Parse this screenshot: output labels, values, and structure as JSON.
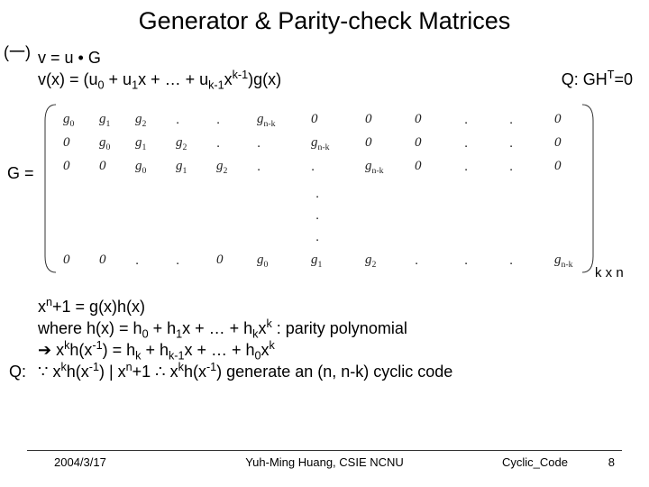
{
  "title": "Generator & Parity-check Matrices",
  "topnote": "(一)",
  "line1": "v = u • G",
  "line2_html": "v(x) = (u<sub>0</sub> + u<sub>1</sub>x + … + u<sub>k-1</sub>x<sup>k-1</sup>)g(x)",
  "q_right_html": "Q: GH<sup>T</sup>=0",
  "g_label": "G =",
  "matrix": {
    "headers_row0": [
      "g<sub>0</sub>",
      "g<sub>1</sub>",
      "g<sub>2</sub>",
      ".",
      ".",
      "g<sub>n-k</sub>",
      "0",
      "0",
      "0",
      ".",
      ".",
      "0"
    ],
    "row1": [
      "0",
      "g<sub>0</sub>",
      "g<sub>1</sub>",
      "g<sub>2</sub>",
      ".",
      ".",
      "g<sub>n-k</sub>",
      "0",
      "0",
      ".",
      ".",
      "0"
    ],
    "row2": [
      "0",
      "0",
      "g<sub>0</sub>",
      "g<sub>1</sub>",
      "g<sub>2</sub>",
      ".",
      ".",
      "g<sub>n-k</sub>",
      "0",
      ".",
      ".",
      "0"
    ],
    "row5": [
      "0",
      "0",
      ".",
      ".",
      "0",
      "g<sub>0</sub>",
      "g<sub>1</sub>",
      "g<sub>2</sub>",
      ".",
      ".",
      ".",
      "g<sub>n-k</sub>"
    ]
  },
  "kxn": "k x n",
  "block2_l1_html": "x<sup>n</sup>+1 = g(x)h(x)",
  "block2_l2_html": "where h(x) = h<sub>0</sub> + h<sub>1</sub>x + … + h<sub>k</sub>x<sup>k</sup> : parity polynomial",
  "block2_l3_html": "➔ x<sup>k</sup>h(x<sup>-1</sup>) = h<sub>k</sub> + h<sub>k-1</sub>x + … + h<sub>0</sub>x<sup>k</sup>",
  "q_left": "Q:",
  "block2_l4_html": "∵ x<sup>k</sup>h(x<sup>-1</sup>) | x<sup>n</sup>+1  ∴ x<sup>k</sup>h(x<sup>-1</sup>) generate an (n, n-k) cyclic code",
  "footer": {
    "date": "2004/3/17",
    "center": "Yuh-Ming Huang, CSIE NCNU",
    "right1": "Cyclic_Code",
    "right2": "8"
  }
}
